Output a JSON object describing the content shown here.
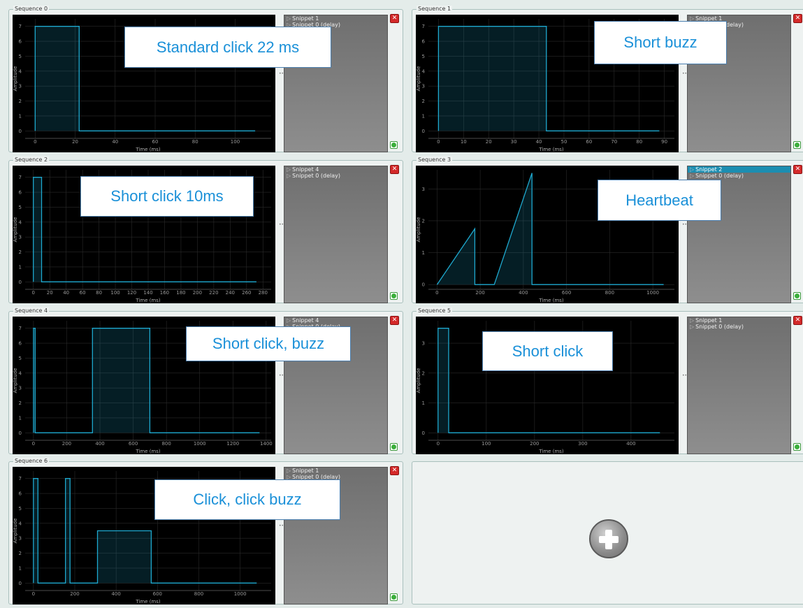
{
  "colors": {
    "waveform": "#1ea9cf",
    "callout_text": "#1a90d8",
    "selected_snippet": "#1c8eb1"
  },
  "panels": [
    {
      "legend": "Sequence 0",
      "snippets": [
        {
          "label": "Snippet 1",
          "selected": false
        },
        {
          "label": "Snippet 0 (delay)",
          "selected": false
        }
      ],
      "callout": "Standard click 22 ms",
      "chart_data": {
        "type": "line",
        "xlabel": "Time (ms)",
        "ylabel": "Amplitude",
        "xlim": [
          -5,
          118
        ],
        "ylim": [
          -0.5,
          7.5
        ],
        "xticks": [
          0,
          20,
          40,
          60,
          80,
          100
        ],
        "yticks": [
          0,
          1,
          2,
          3,
          4,
          5,
          6,
          7
        ],
        "x": [
          0,
          0,
          22,
          22,
          110
        ],
        "y": [
          0,
          7,
          7,
          0,
          0
        ]
      }
    },
    {
      "legend": "Sequence 1",
      "snippets": [
        {
          "label": "Snippet 1",
          "selected": false
        },
        {
          "label": "Snippet 0 (delay)",
          "selected": false
        }
      ],
      "callout": "Short buzz",
      "chart_data": {
        "type": "line",
        "xlabel": "Time (ms)",
        "ylabel": "Amplitude",
        "xlim": [
          -4,
          94
        ],
        "ylim": [
          -0.5,
          7.5
        ],
        "xticks": [
          0,
          10,
          20,
          30,
          40,
          50,
          60,
          70,
          80,
          90
        ],
        "yticks": [
          0,
          1,
          2,
          3,
          4,
          5,
          6,
          7
        ],
        "x": [
          0,
          0,
          43,
          43,
          88
        ],
        "y": [
          0,
          7,
          7,
          0,
          0
        ]
      }
    },
    {
      "legend": "Sequence 2",
      "snippets": [
        {
          "label": "Snippet 4",
          "selected": false
        },
        {
          "label": "Snippet 0 (delay)",
          "selected": false
        }
      ],
      "callout": "Short click 10ms",
      "chart_data": {
        "type": "line",
        "xlabel": "Time (ms)",
        "ylabel": "Amplitude",
        "xlim": [
          -10,
          290
        ],
        "ylim": [
          -0.5,
          7.5
        ],
        "xticks": [
          0,
          20,
          40,
          60,
          80,
          100,
          120,
          140,
          160,
          180,
          200,
          220,
          240,
          260,
          280
        ],
        "yticks": [
          0,
          1,
          2,
          3,
          4,
          5,
          6,
          7
        ],
        "x": [
          0,
          0,
          10,
          10,
          272
        ],
        "y": [
          0,
          7,
          7,
          0,
          0
        ]
      }
    },
    {
      "legend": "Sequence 3",
      "snippets": [
        {
          "label": "Snippet 2",
          "selected": true
        },
        {
          "label": "Snippet 0 (delay)",
          "selected": false
        }
      ],
      "callout": "Heartbeat",
      "chart_data": {
        "type": "line",
        "xlabel": "Time (ms)",
        "ylabel": "Amplitude",
        "xlim": [
          -40,
          1100
        ],
        "ylim": [
          -0.15,
          3.6
        ],
        "xticks": [
          0,
          200,
          400,
          600,
          800,
          1000
        ],
        "yticks": [
          0,
          1,
          2,
          3
        ],
        "x": [
          0,
          175,
          175,
          260,
          265,
          440,
          440,
          1050
        ],
        "y": [
          0,
          1.75,
          0,
          0,
          0,
          3.5,
          0,
          0
        ]
      }
    },
    {
      "legend": "Sequence 4",
      "snippets": [
        {
          "label": "Snippet 4",
          "selected": false
        },
        {
          "label": "Snippet 0 (delay)",
          "selected": false
        }
      ],
      "callout": "Short click, buzz",
      "chart_data": {
        "type": "line",
        "xlabel": "Time (ms)",
        "ylabel": "Amplitude",
        "xlim": [
          -50,
          1430
        ],
        "ylim": [
          -0.5,
          7.5
        ],
        "xticks": [
          0,
          200,
          400,
          600,
          800,
          1000,
          1200,
          1400
        ],
        "yticks": [
          0,
          1,
          2,
          3,
          4,
          5,
          6,
          7
        ],
        "x": [
          0,
          0,
          10,
          10,
          355,
          355,
          700,
          700,
          1360
        ],
        "y": [
          0,
          7,
          7,
          0,
          0,
          7,
          7,
          0,
          0
        ]
      }
    },
    {
      "legend": "Sequence 5",
      "snippets": [
        {
          "label": "Snippet 1",
          "selected": false
        },
        {
          "label": "Snippet 0 (delay)",
          "selected": false
        }
      ],
      "callout": "Short click",
      "chart_data": {
        "type": "line",
        "xlabel": "Time (ms)",
        "ylabel": "Amplitude",
        "xlim": [
          -20,
          490
        ],
        "ylim": [
          -0.25,
          3.75
        ],
        "xticks": [
          0,
          100,
          200,
          300,
          400
        ],
        "yticks": [
          0,
          1,
          2,
          3
        ],
        "x": [
          0,
          0,
          22,
          22,
          460
        ],
        "y": [
          0,
          3.5,
          3.5,
          0,
          0
        ]
      }
    },
    {
      "legend": "Sequence 6",
      "snippets": [
        {
          "label": "Snippet 1",
          "selected": false
        },
        {
          "label": "Snippet 0 (delay)",
          "selected": false
        }
      ],
      "callout": "Click, click buzz",
      "chart_data": {
        "type": "line",
        "xlabel": "Time (ms)",
        "ylabel": "Amplitude",
        "xlim": [
          -40,
          1150
        ],
        "ylim": [
          -0.5,
          7.5
        ],
        "xticks": [
          0,
          200,
          400,
          600,
          800,
          1000
        ],
        "yticks": [
          0,
          1,
          2,
          3,
          4,
          5,
          6,
          7
        ],
        "x": [
          0,
          0,
          22,
          22,
          155,
          155,
          177,
          177,
          310,
          310,
          570,
          570,
          1080
        ],
        "y": [
          0,
          7,
          7,
          0,
          0,
          7,
          7,
          0,
          0,
          3.5,
          3.5,
          0,
          0
        ]
      }
    }
  ]
}
